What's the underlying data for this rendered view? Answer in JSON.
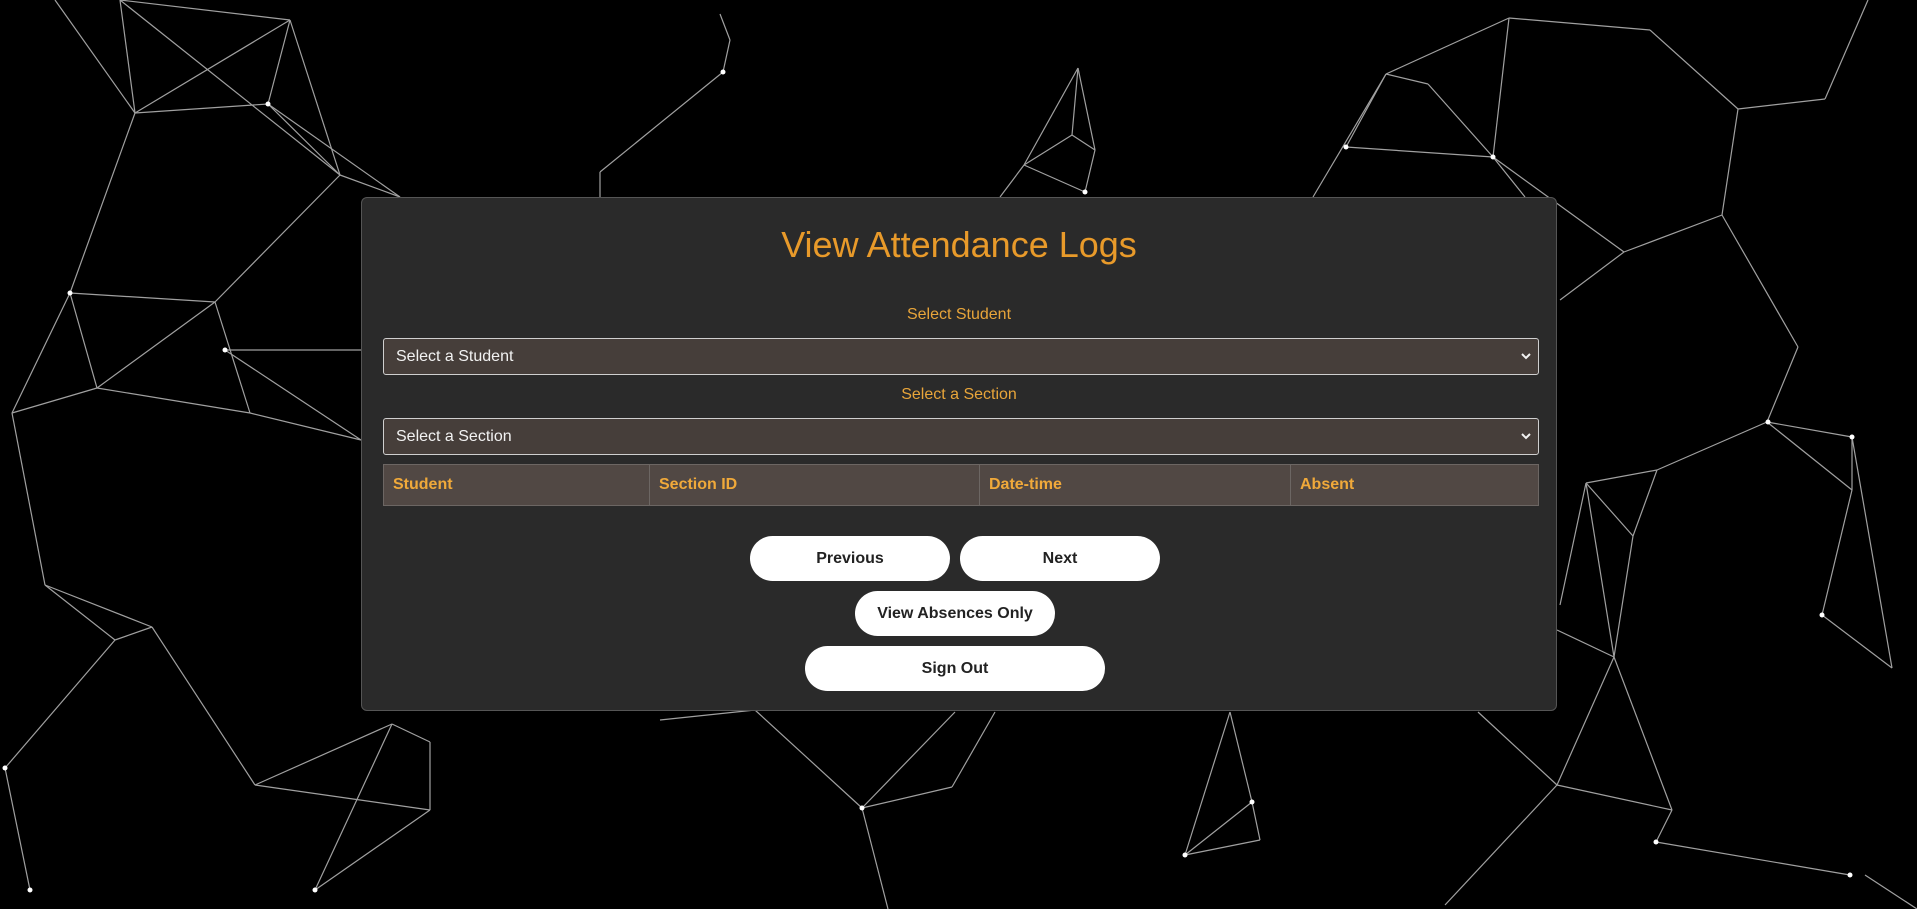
{
  "page": {
    "title": "View Attendance Logs"
  },
  "student_select": {
    "label": "Select Student",
    "value": "Select a Student"
  },
  "section_select": {
    "label": "Select a Section",
    "value": "Select a Section"
  },
  "table": {
    "columns": [
      "Student",
      "Section ID",
      "Date-time",
      "Absent"
    ],
    "rows": []
  },
  "buttons": {
    "previous": "Previous",
    "next": "Next",
    "absences_only": "View Absences Only",
    "sign_out": "Sign Out"
  },
  "colors": {
    "accent": "#e89a2a",
    "panel_bg": "#2a2a2a",
    "select_bg": "#463e3a",
    "table_head_bg": "#514844",
    "background": "#000000"
  },
  "icons": {
    "select_arrow": "chevron-down-icon"
  }
}
